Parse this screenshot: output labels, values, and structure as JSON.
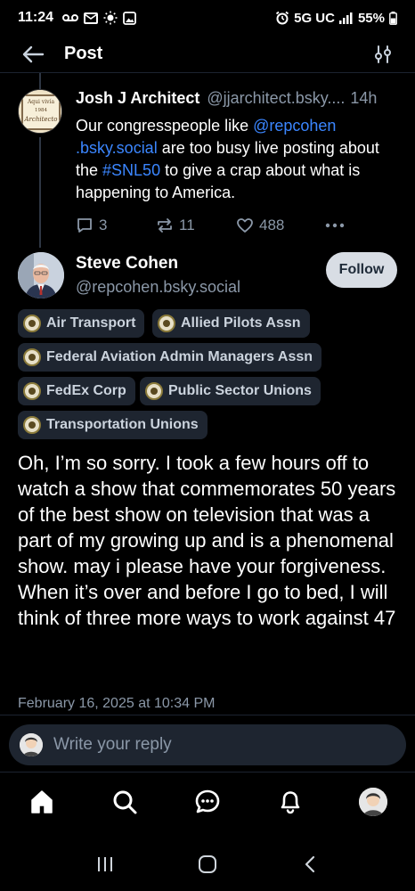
{
  "status_bar": {
    "time": "11:24",
    "network": "5G UC",
    "battery": "55%",
    "left_icons": [
      "voicemail-icon",
      "mail-icon",
      "weather-icon",
      "gallery-icon"
    ],
    "right_icons": [
      "alarm-icon",
      "signal-icon",
      "battery-icon"
    ]
  },
  "header": {
    "title": "Post",
    "back_icon": "arrow-left-icon",
    "settings_icon": "sliders-icon"
  },
  "parent_post": {
    "author_name": "Josh J Architect",
    "author_handle": "@jjarchitect.bsky....",
    "time_ago": "14h",
    "avatar_text": [
      "Aqui vivía",
      "1984",
      "Architecto"
    ],
    "text_before": "Our congresspeople like ",
    "mention": "@repcohen .bsky.social",
    "text_middle": " are too busy live posting about the ",
    "hashtag": "#SNL50",
    "text_after": " to give a crap about what is happening to America.",
    "replies": "3",
    "reposts": "11",
    "likes": "488"
  },
  "main_post": {
    "author_name": "Steve Cohen",
    "author_handle": "@repcohen.bsky.social",
    "follow_label": "Follow",
    "tags": [
      "Air Transport",
      "Allied Pilots Assn",
      "Federal Aviation Admin Managers Assn",
      "FedEx Corp",
      "Public Sector Unions",
      "Transportation Unions"
    ],
    "text": "Oh, I’m so sorry. I took a few hours off to watch a show that commemorates 50 years of the best show on television that was a part of my growing up and is a phenomenal show. may i please have your forgiveness. When it’s over and before I go to bed, I will think of three more ways to work against 47",
    "date": "February 16, 2025 at 10:34 PM"
  },
  "reply": {
    "placeholder": "Write your reply"
  },
  "bottom_nav": [
    "home-icon",
    "search-icon",
    "chat-icon",
    "bell-icon",
    "profile-avatar"
  ],
  "system_nav": [
    "recents-icon",
    "home-circle-icon",
    "back-chevron-icon"
  ]
}
